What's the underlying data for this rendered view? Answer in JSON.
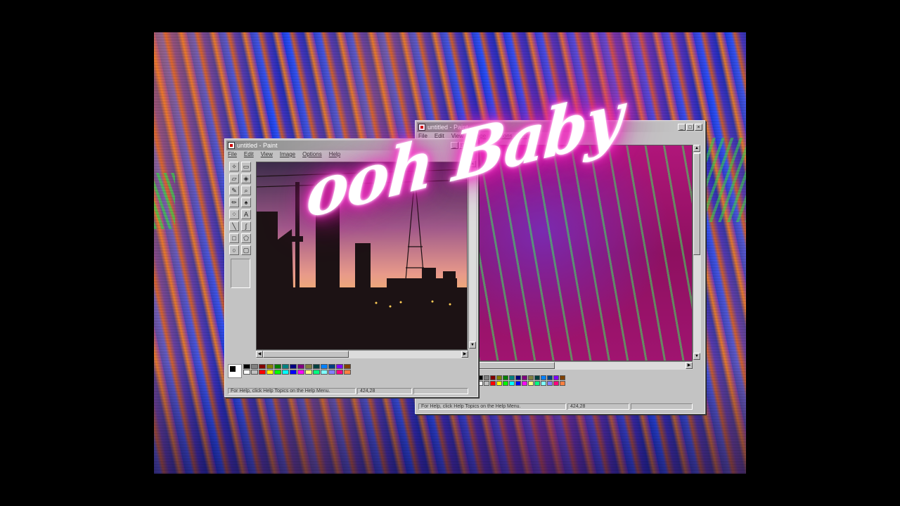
{
  "overlay_text": "ooh Baby",
  "paint_back": {
    "title": "untitled - Paint",
    "menu": [
      "File",
      "Edit",
      "View",
      "Image",
      "Options",
      "Help"
    ],
    "status_help": "For Help, click Help Topics on the Help Menu.",
    "coords": "424,28",
    "window_buttons": [
      "_",
      "□",
      "×"
    ]
  },
  "paint_front": {
    "title": "untitled - Paint",
    "menu": [
      "File",
      "Edit",
      "View",
      "Image",
      "Options",
      "Help"
    ],
    "status_help": "For Help, click Help Topics on the Help Menu.",
    "coords": "424,28",
    "window_buttons": [
      "_",
      "□",
      "×"
    ],
    "tools": [
      "free-select",
      "select",
      "eraser",
      "fill",
      "pick-color",
      "magnifier",
      "pencil",
      "brush",
      "airbrush",
      "text",
      "line",
      "curve",
      "rectangle",
      "polygon",
      "ellipse",
      "rounded-rectangle"
    ]
  },
  "palette_colors": [
    "#000000",
    "#808080",
    "#800000",
    "#808000",
    "#008000",
    "#008080",
    "#000080",
    "#800080",
    "#808040",
    "#004040",
    "#0080ff",
    "#004080",
    "#8000ff",
    "#804000",
    "#ffffff",
    "#c0c0c0",
    "#ff0000",
    "#ffff00",
    "#00ff00",
    "#00ffff",
    "#0000ff",
    "#ff00ff",
    "#ffff80",
    "#00ff80",
    "#80ffff",
    "#8080ff",
    "#ff0080",
    "#ff8040"
  ],
  "colors": {
    "neon": "#ff2fc8",
    "window_face": "#c3c3c3"
  }
}
